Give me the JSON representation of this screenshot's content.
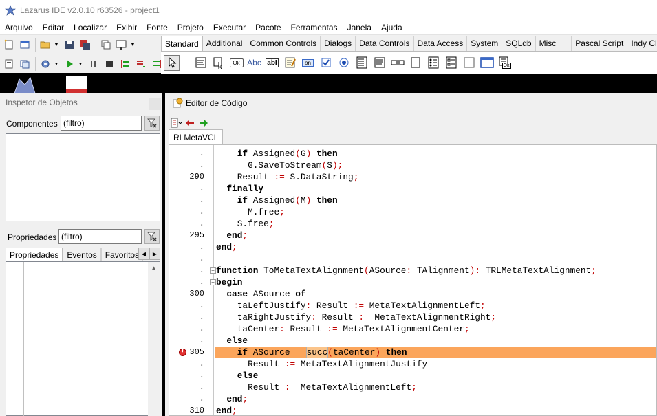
{
  "window": {
    "title": "Lazarus IDE v2.0.10 r63526 - project1"
  },
  "menu": [
    "Arquivo",
    "Editar",
    "Localizar",
    "Exibir",
    "Fonte",
    "Projeto",
    "Executar",
    "Pacote",
    "Ferramentas",
    "Janela",
    "Ajuda"
  ],
  "palette": {
    "tabs": [
      "Standard",
      "Additional",
      "Common Controls",
      "Dialogs",
      "Data Controls",
      "Data Access",
      "System",
      "SQLdb",
      "Misc",
      "Pascal Script",
      "Indy Clie"
    ],
    "active_tab": "Standard",
    "button_captions": {
      "ok": "Ok",
      "abc": "Abc",
      "abi": "abI",
      "on": "on",
      "ok2": "Ok"
    }
  },
  "object_inspector": {
    "title": "Inspetor de Objetos",
    "components_label": "Componentes",
    "components_filter": "(filtro)",
    "properties_label": "Propriedades",
    "properties_filter": "(filtro)",
    "tabs": [
      "Propriedades",
      "Eventos",
      "Favoritos"
    ],
    "active_tab": "Propriedades"
  },
  "code_editor": {
    "title": "Editor de Código",
    "file_tab": "RLMetaVCL",
    "highlight_color": "#fba55b",
    "lines": [
      {
        "num": ".",
        "text": "    if Assigned(G) then"
      },
      {
        "num": ".",
        "text": "      G.SaveToStream(S);"
      },
      {
        "num": "290",
        "text": "    Result := S.DataString;"
      },
      {
        "num": ".",
        "text": "  finally"
      },
      {
        "num": ".",
        "text": "    if Assigned(M) then"
      },
      {
        "num": ".",
        "text": "      M.free;"
      },
      {
        "num": ".",
        "text": "    S.free;"
      },
      {
        "num": "295",
        "text": "  end;"
      },
      {
        "num": ".",
        "text": "end;"
      },
      {
        "num": ".",
        "text": ""
      },
      {
        "num": ".",
        "text": "function ToMetaTextAlignment(ASource: TAlignment): TRLMetaTextAlignment;"
      },
      {
        "num": ".",
        "text": "begin"
      },
      {
        "num": "300",
        "text": "  case ASource of"
      },
      {
        "num": ".",
        "text": "    taLeftJustify: Result := MetaTextAlignmentLeft;"
      },
      {
        "num": ".",
        "text": "    taRightJustify: Result := MetaTextAlignmentRight;"
      },
      {
        "num": ".",
        "text": "    taCenter: Result := MetaTextAlignmentCenter;"
      },
      {
        "num": ".",
        "text": "  else"
      },
      {
        "num": "305",
        "text": "    if ASource = succ(taCenter) then"
      },
      {
        "num": ".",
        "text": "      Result := MetaTextAlignmentJustify"
      },
      {
        "num": ".",
        "text": "    else"
      },
      {
        "num": ".",
        "text": "      Result := MetaTextAlignmentLeft;"
      },
      {
        "num": ".",
        "text": "  end;"
      },
      {
        "num": "310",
        "text": "end;"
      }
    ],
    "error_line": "305"
  }
}
